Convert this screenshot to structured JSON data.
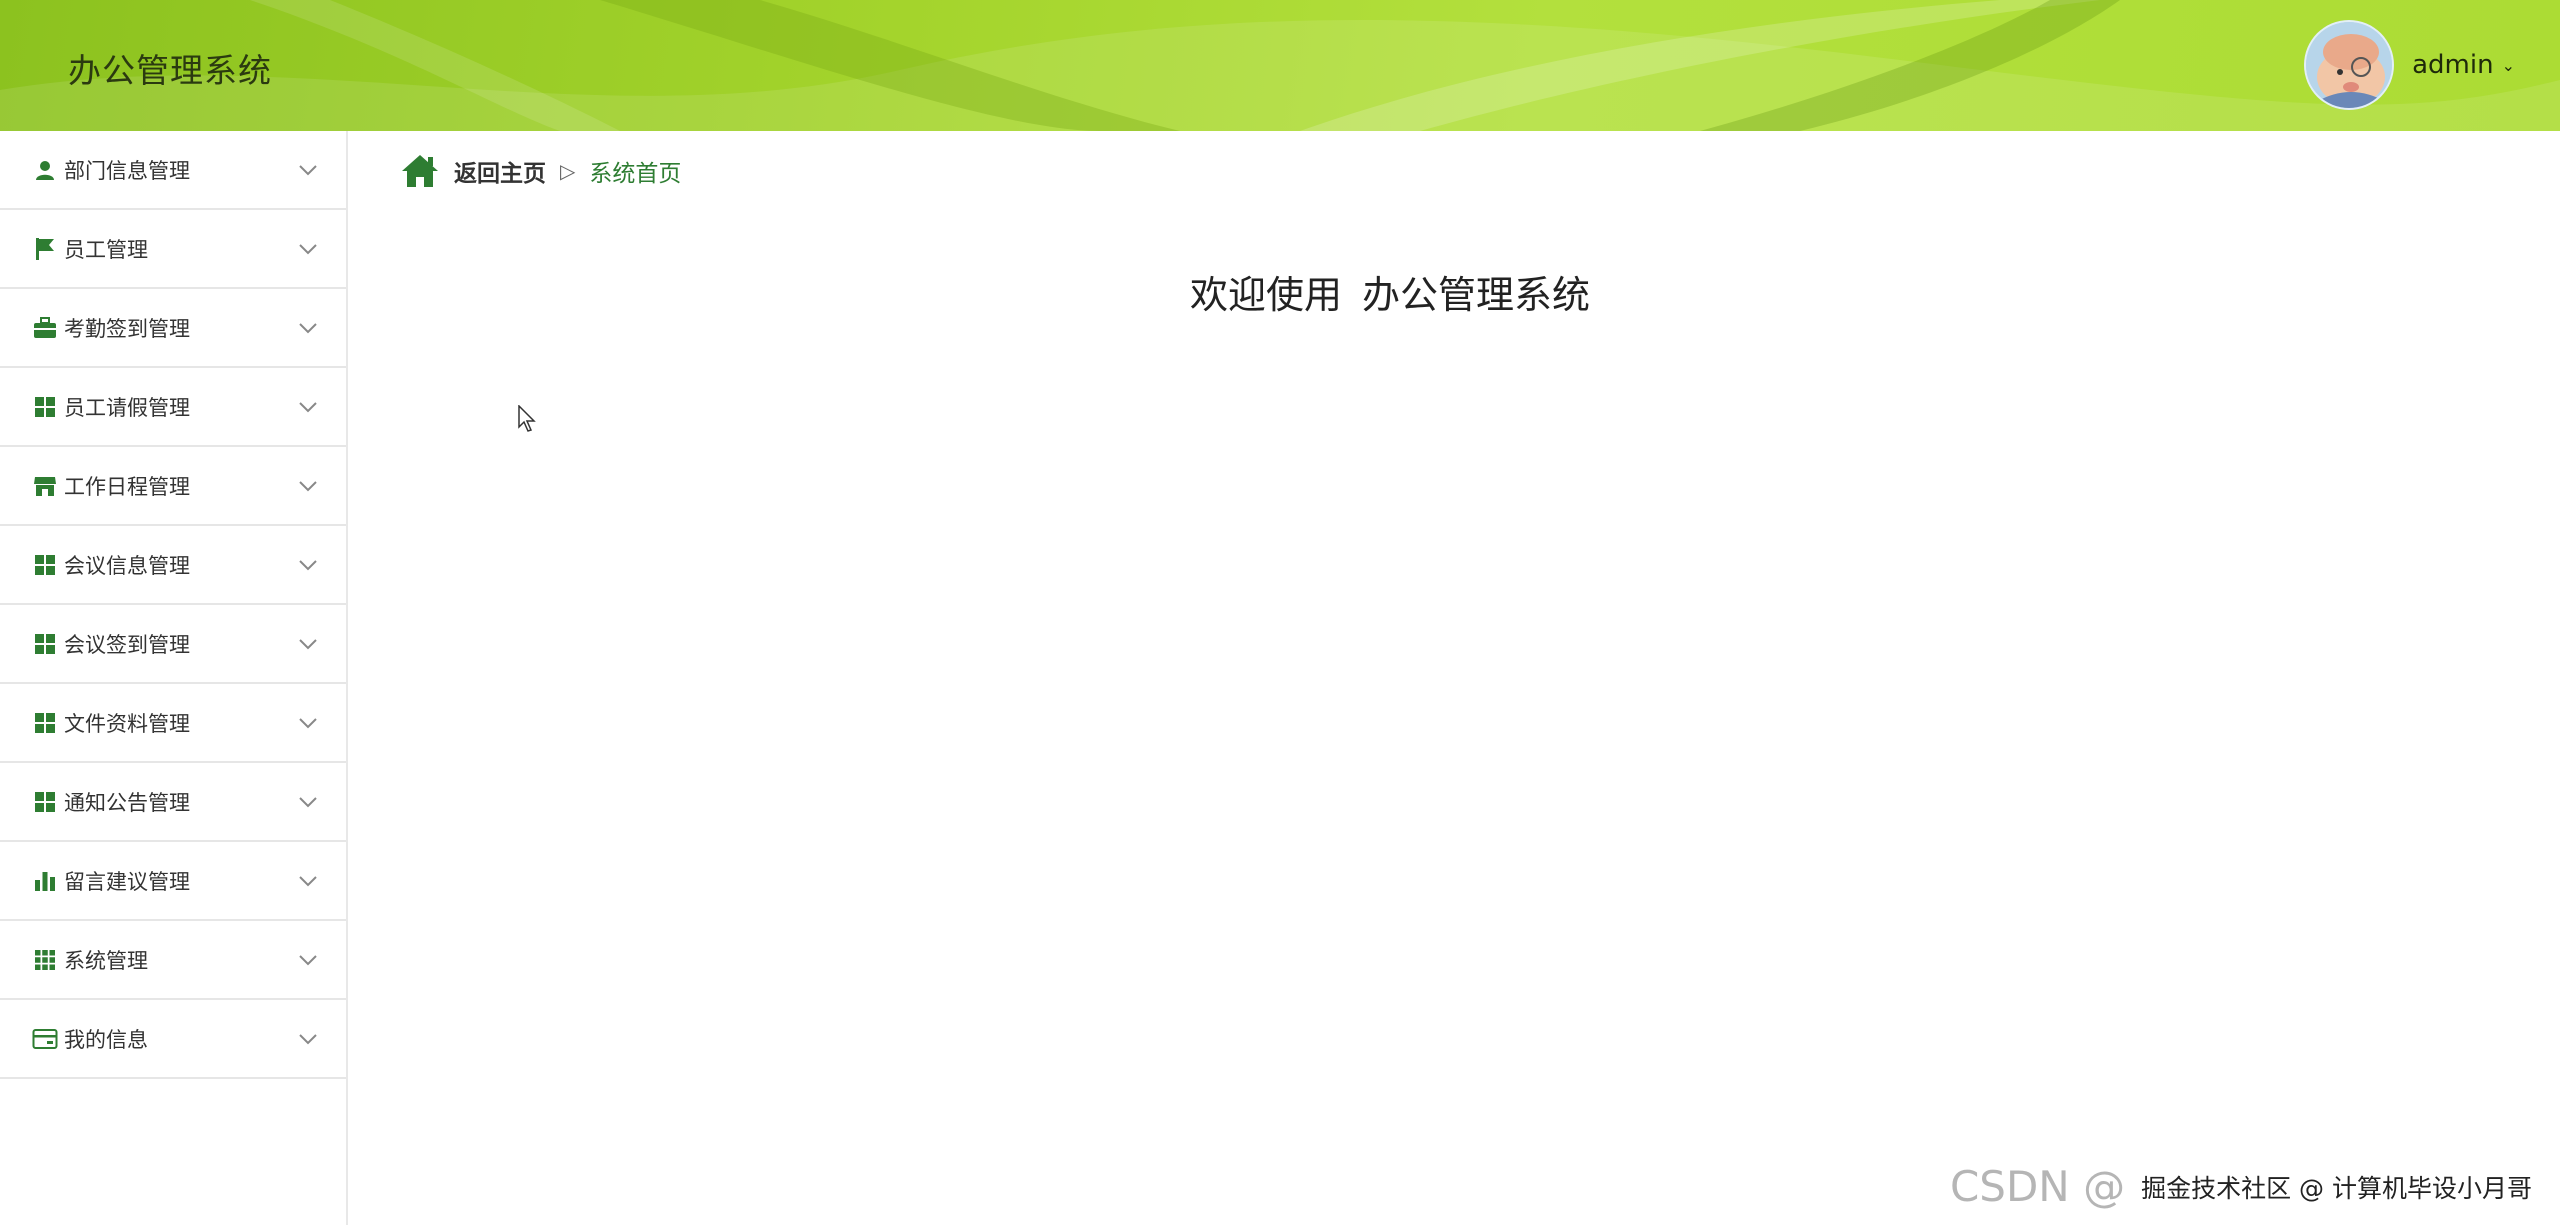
{
  "header": {
    "title": "办公管理系统",
    "username": "admin",
    "caret": "⌄"
  },
  "sidebar": {
    "items": [
      {
        "label": "部门信息管理",
        "icon": "user-icon"
      },
      {
        "label": "员工管理",
        "icon": "flag-icon"
      },
      {
        "label": "考勤签到管理",
        "icon": "briefcase-icon"
      },
      {
        "label": "员工请假管理",
        "icon": "grid-icon"
      },
      {
        "label": "工作日程管理",
        "icon": "store-icon"
      },
      {
        "label": "会议信息管理",
        "icon": "grid-icon"
      },
      {
        "label": "会议签到管理",
        "icon": "grid-icon"
      },
      {
        "label": "文件资料管理",
        "icon": "grid-icon"
      },
      {
        "label": "通知公告管理",
        "icon": "grid-icon"
      },
      {
        "label": "留言建议管理",
        "icon": "bar-chart-icon"
      },
      {
        "label": "系统管理",
        "icon": "apps-icon"
      },
      {
        "label": "我的信息",
        "icon": "card-icon"
      }
    ]
  },
  "breadcrumb": {
    "home": "返回主页",
    "separator": "▷",
    "current": "系统首页"
  },
  "main": {
    "welcome_prefix": "欢迎使用",
    "welcome_system": "办公管理系统"
  },
  "watermark": {
    "csdn": "CSDN @",
    "community": "掘金技术社区 @ 计算机毕设小月哥"
  },
  "colors": {
    "accent_green": "#2e7d32",
    "header_green": "#a4d42c"
  }
}
